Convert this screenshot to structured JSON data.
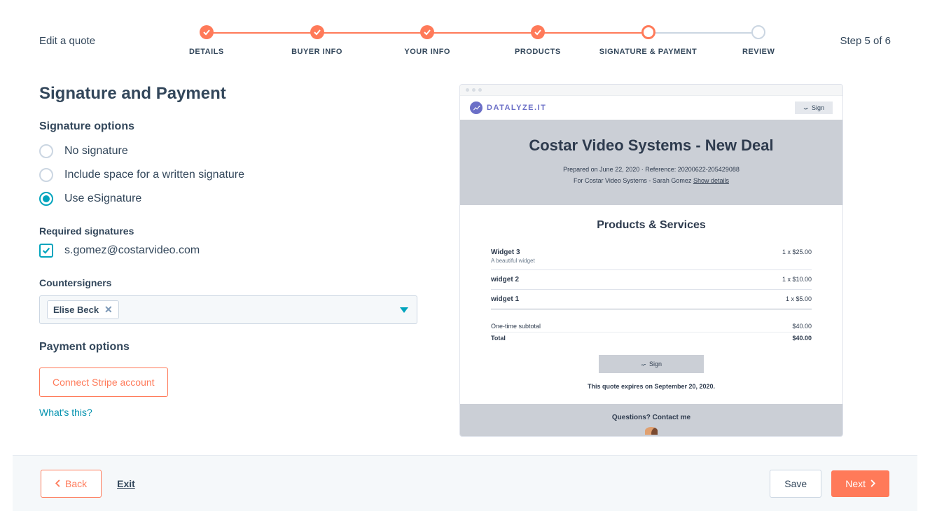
{
  "header": {
    "edit_label": "Edit a quote",
    "step_counter": "Step 5 of 6",
    "steps": [
      {
        "label": "DETAILS",
        "state": "done"
      },
      {
        "label": "BUYER INFO",
        "state": "done"
      },
      {
        "label": "YOUR INFO",
        "state": "done"
      },
      {
        "label": "PRODUCTS",
        "state": "done"
      },
      {
        "label": "SIGNATURE & PAYMENT",
        "state": "current"
      },
      {
        "label": "REVIEW",
        "state": "future"
      }
    ]
  },
  "left": {
    "h1": "Signature and Payment",
    "sig_options_label": "Signature options",
    "radios": {
      "none": "No signature",
      "written": "Include space for a written signature",
      "esig": "Use eSignature"
    },
    "selected_radio": "esig",
    "req_sig_label": "Required signatures",
    "req_sig_email": "s.gomez@costarvideo.com",
    "countersigners_label": "Countersigners",
    "countersigner_chip": "Elise Beck",
    "payment_options_label": "Payment options",
    "stripe_button": "Connect Stripe account",
    "whats_this": "What's this?"
  },
  "preview": {
    "brand": "DATALYZE.IT",
    "sign_button": "Sign",
    "title": "Costar Video Systems - New Deal",
    "prepared": "Prepared on June 22, 2020 · Reference: 20200622-205429088",
    "for_line_prefix": "For Costar Video Systems - Sarah Gomez ",
    "show_details": "Show details",
    "products_heading": "Products & Services",
    "items": [
      {
        "name": "Widget 3",
        "desc": "A beautiful widget",
        "price": "1 x $25.00"
      },
      {
        "name": "widget 2",
        "desc": "",
        "price": "1 x $10.00"
      },
      {
        "name": "widget 1",
        "desc": "",
        "price": "1 x $5.00"
      }
    ],
    "subtotal_label": "One-time subtotal",
    "subtotal_value": "$40.00",
    "total_label": "Total",
    "total_value": "$40.00",
    "expires": "This quote expires on September 20, 2020.",
    "questions": "Questions? Contact me"
  },
  "footer": {
    "back": "Back",
    "exit": "Exit",
    "save": "Save",
    "next": "Next"
  }
}
